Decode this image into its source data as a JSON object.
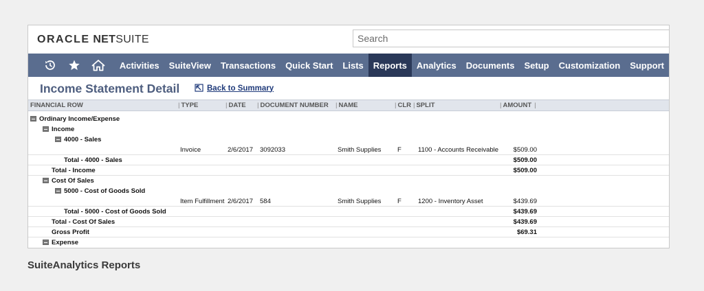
{
  "logo": {
    "oracle": "ORACLE",
    "net": "NET",
    "suite": "SUITE"
  },
  "search": {
    "placeholder": "Search"
  },
  "nav": {
    "icons": [
      "recent-records-icon",
      "star-icon",
      "home-icon"
    ],
    "items": [
      {
        "label": "Activities"
      },
      {
        "label": "SuiteView"
      },
      {
        "label": "Transactions"
      },
      {
        "label": "Quick Start"
      },
      {
        "label": "Lists"
      },
      {
        "label": "Reports",
        "active": true
      },
      {
        "label": "Analytics"
      },
      {
        "label": "Documents"
      },
      {
        "label": "Setup"
      },
      {
        "label": "Customization"
      },
      {
        "label": "Support"
      }
    ]
  },
  "title": "Income Statement Detail",
  "back_link": "Back to Summary",
  "columns": {
    "financial_row": "FINANCIAL ROW",
    "type": "TYPE",
    "date": "DATE",
    "document_number": "DOCUMENT NUMBER",
    "name": "NAME",
    "clr": "CLR",
    "split": "SPLIT",
    "amount": "AMOUNT"
  },
  "rows": [
    {
      "label": "Ordinary Income/Expense"
    },
    {
      "label": "Income"
    },
    {
      "label": "4000 - Sales"
    },
    {
      "type": "Invoice",
      "date": "2/6/2017",
      "doc": "3092033",
      "name": "Smith Supplies",
      "clr": "F",
      "split": "1100 - Accounts Receivable",
      "amount": "$509.00"
    },
    {
      "label": "Total - 4000 - Sales",
      "amount": "$509.00"
    },
    {
      "label": "Total - Income",
      "amount": "$509.00"
    },
    {
      "label": "Cost Of Sales"
    },
    {
      "label": "5000 - Cost of Goods Sold"
    },
    {
      "type": "Item Fulfillment",
      "date": "2/6/2017",
      "doc": "584",
      "name": "Smith Supplies",
      "clr": "F",
      "split": "1200 - Inventory Asset",
      "amount": "$439.69"
    },
    {
      "label": "Total - 5000 - Cost of Goods Sold",
      "amount": "$439.69"
    },
    {
      "label": "Total - Cost Of Sales",
      "amount": "$439.69"
    },
    {
      "label": "Gross Profit",
      "amount": "$69.31"
    },
    {
      "label": "Expense"
    }
  ],
  "caption": "SuiteAnalytics Reports"
}
